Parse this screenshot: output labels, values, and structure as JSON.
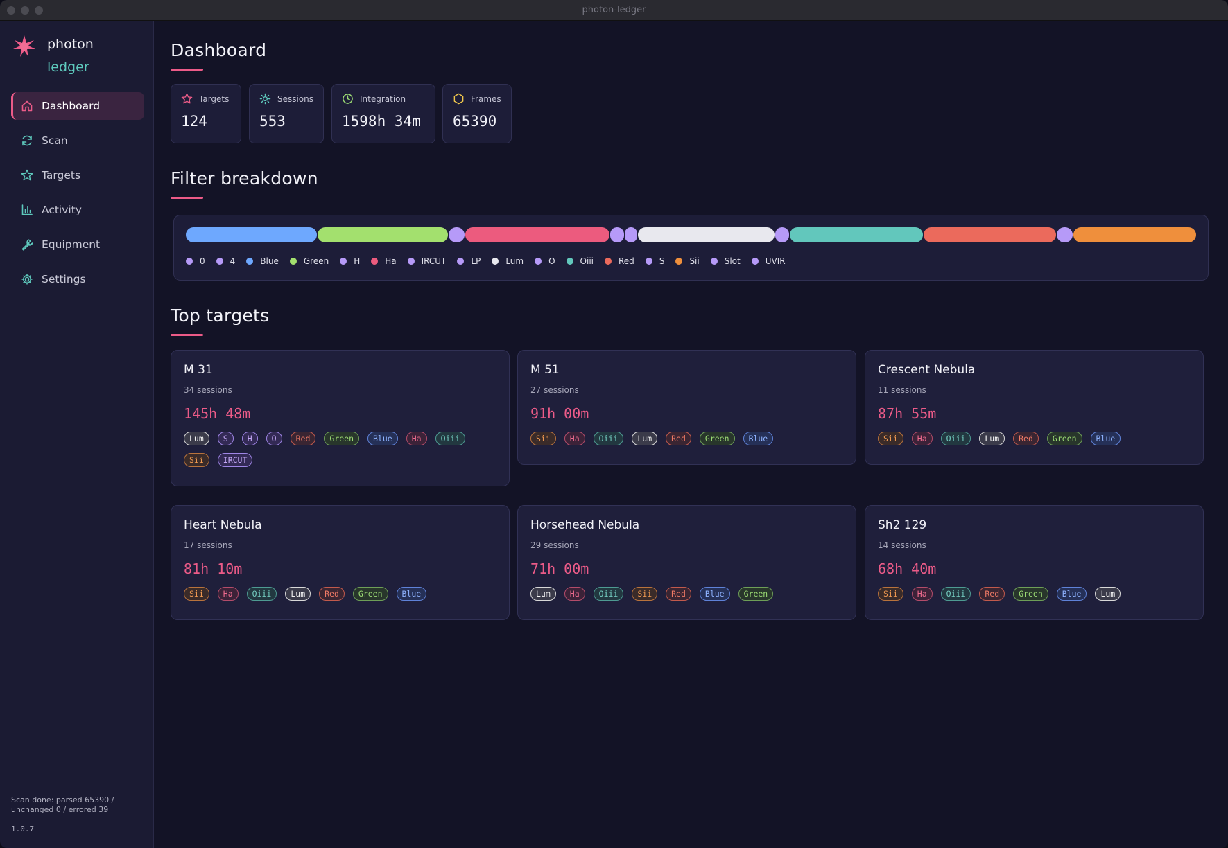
{
  "window": {
    "title": "photon-ledger"
  },
  "brand": {
    "line1": "photon",
    "line2": "ledger"
  },
  "nav": [
    {
      "label": "Dashboard",
      "icon": "home-icon",
      "active": true
    },
    {
      "label": "Scan",
      "icon": "refresh-icon",
      "active": false
    },
    {
      "label": "Targets",
      "icon": "star-icon",
      "active": false
    },
    {
      "label": "Activity",
      "icon": "bar-chart-icon",
      "active": false
    },
    {
      "label": "Equipment",
      "icon": "wrench-icon",
      "active": false
    },
    {
      "label": "Settings",
      "icon": "gear-icon",
      "active": false
    }
  ],
  "status": {
    "scan": "Scan done: parsed 65390 / unchanged 0 / errored 39",
    "version": "1.0.7"
  },
  "dashboard": {
    "title": "Dashboard",
    "stats": [
      {
        "label": "Targets",
        "value": "124",
        "icon": "star-icon",
        "color": "#ec5b88"
      },
      {
        "label": "Sessions",
        "value": "553",
        "icon": "sun-icon",
        "color": "#5ec9bd"
      },
      {
        "label": "Integration",
        "value": "1598h 34m",
        "icon": "clock-icon",
        "color": "#9cdb74"
      },
      {
        "label": "Frames",
        "value": "65390",
        "icon": "hexagon-icon",
        "color": "#f2c94c"
      }
    ]
  },
  "filter_breakdown": {
    "title": "Filter breakdown",
    "legend": [
      {
        "label": "0",
        "color": "#b69af8"
      },
      {
        "label": "4",
        "color": "#b69af8"
      },
      {
        "label": "Blue",
        "color": "#6ea8fe"
      },
      {
        "label": "Green",
        "color": "#a3e06e"
      },
      {
        "label": "H",
        "color": "#b69af8"
      },
      {
        "label": "Ha",
        "color": "#ec5b7e"
      },
      {
        "label": "IRCUT",
        "color": "#b69af8"
      },
      {
        "label": "LP",
        "color": "#b69af8"
      },
      {
        "label": "Lum",
        "color": "#e8e8ee"
      },
      {
        "label": "O",
        "color": "#b69af8"
      },
      {
        "label": "Oiii",
        "color": "#62c7bc"
      },
      {
        "label": "Red",
        "color": "#eb6a5c"
      },
      {
        "label": "S",
        "color": "#b69af8"
      },
      {
        "label": "Sii",
        "color": "#ef8f3c"
      },
      {
        "label": "Slot",
        "color": "#b69af8"
      },
      {
        "label": "UVIR",
        "color": "#b69af8"
      }
    ],
    "segments": [
      {
        "filter": "Blue",
        "share": 0.131
      },
      {
        "filter": "Green",
        "share": 0.131
      },
      {
        "filter": "H",
        "share": 0.016
      },
      {
        "filter": "Ha",
        "share": 0.144
      },
      {
        "filter": "IRCUT",
        "share": 0.014
      },
      {
        "filter": "LP",
        "share": 0.012
      },
      {
        "filter": "Lum",
        "share": 0.137
      },
      {
        "filter": "O",
        "share": 0.014
      },
      {
        "filter": "Oiii",
        "share": 0.133
      },
      {
        "filter": "Red",
        "share": 0.133
      },
      {
        "filter": "S",
        "share": 0.016
      },
      {
        "filter": "Sii",
        "share": 0.129
      },
      {
        "filter": "UVIR",
        "share": 0.002
      }
    ]
  },
  "top_targets": {
    "title": "Top targets",
    "items": [
      {
        "name": "M 31",
        "sessions": "34 sessions",
        "integration": "145h 48m",
        "filters": [
          "Lum",
          "S",
          "H",
          "O",
          "Red",
          "Green",
          "Blue",
          "Ha",
          "Oiii",
          "Sii",
          "IRCUT"
        ]
      },
      {
        "name": "M 51",
        "sessions": "27 sessions",
        "integration": "91h 00m",
        "filters": [
          "Sii",
          "Ha",
          "Oiii",
          "Lum",
          "Red",
          "Green",
          "Blue"
        ]
      },
      {
        "name": "Crescent Nebula",
        "sessions": "11 sessions",
        "integration": "87h 55m",
        "filters": [
          "Sii",
          "Ha",
          "Oiii",
          "Lum",
          "Red",
          "Green",
          "Blue"
        ]
      },
      {
        "name": "Heart Nebula",
        "sessions": "17 sessions",
        "integration": "81h 10m",
        "filters": [
          "Sii",
          "Ha",
          "Oiii",
          "Lum",
          "Red",
          "Green",
          "Blue"
        ]
      },
      {
        "name": "Horsehead Nebula",
        "sessions": "29 sessions",
        "integration": "71h 00m",
        "filters": [
          "Lum",
          "Ha",
          "Oiii",
          "Sii",
          "Red",
          "Blue",
          "Green"
        ]
      },
      {
        "name": "Sh2 129",
        "sessions": "14 sessions",
        "integration": "68h 40m",
        "filters": [
          "Sii",
          "Ha",
          "Oiii",
          "Red",
          "Green",
          "Blue",
          "Lum"
        ]
      }
    ]
  }
}
